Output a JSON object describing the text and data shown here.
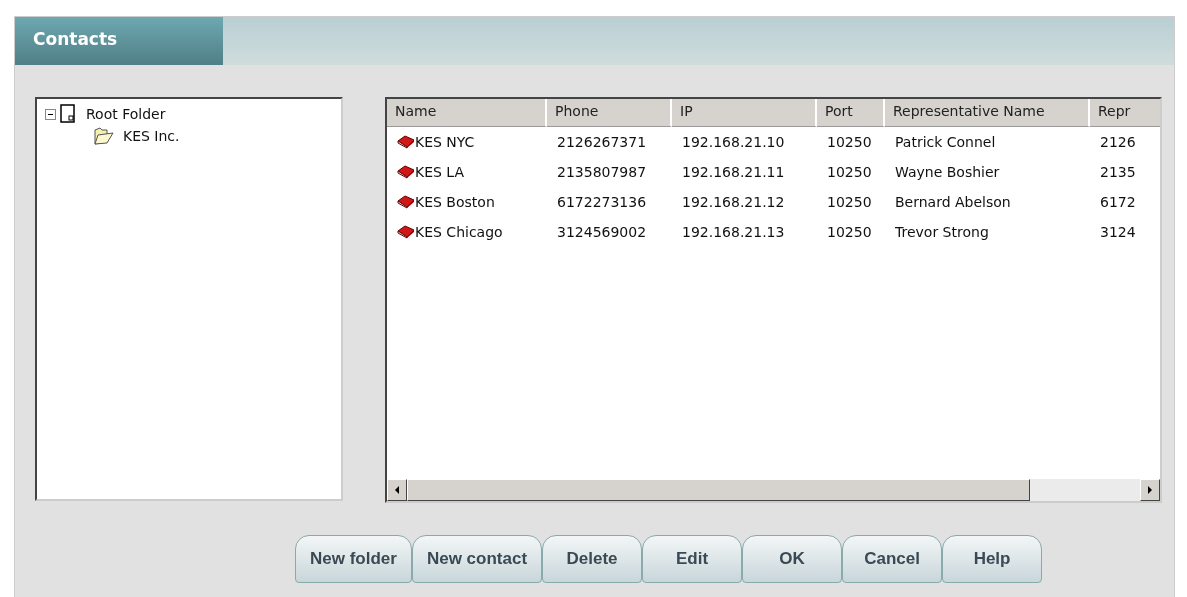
{
  "window": {
    "title": "Contacts"
  },
  "tree": [
    {
      "label": "Root Folder",
      "expanded": true,
      "children": [
        {
          "label": "KES Inc."
        }
      ]
    }
  ],
  "table": {
    "columns": [
      "Name",
      "Phone",
      "IP",
      "Port",
      "Representative Name",
      "Repr"
    ],
    "rows": [
      {
        "name": "KES NYC",
        "phone": "2126267371",
        "ip": "192.168.21.10",
        "port": "10250",
        "representative_name": "Patrick Connel",
        "column_6": "2126"
      },
      {
        "name": "KES LA",
        "phone": "2135807987",
        "ip": "192.168.21.11",
        "port": "10250",
        "representative_name": "Wayne Boshier",
        "column_6": "2135"
      },
      {
        "name": "KES Boston",
        "phone": "6172273136",
        "ip": "192.168.21.12",
        "port": "10250",
        "representative_name": "Bernard Abelson",
        "column_6": "6172"
      },
      {
        "name": "KES Chicago",
        "phone": "3124569002",
        "ip": "192.168.21.13",
        "port": "10250",
        "representative_name": "Trevor Strong",
        "column_6": "3124"
      }
    ]
  },
  "buttons": [
    "New folder",
    "New contact",
    "Delete",
    "Edit",
    "OK",
    "Cancel",
    "Help"
  ]
}
